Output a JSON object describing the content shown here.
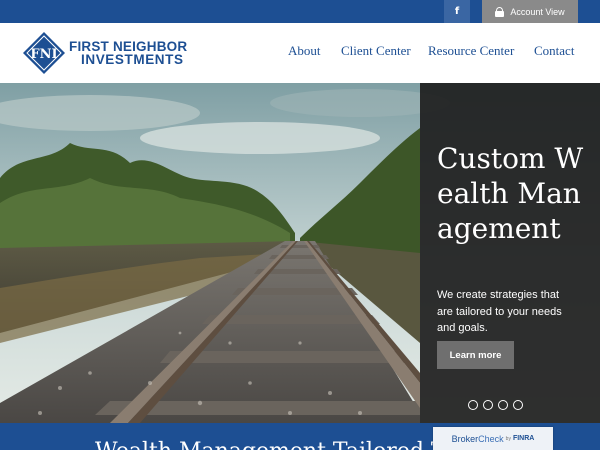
{
  "topbar": {
    "facebook_label": "f",
    "account_label": "Account View"
  },
  "logo": {
    "monogram": "FNI",
    "line1": "FIRST NEIGHBOR",
    "line2": "INVESTMENTS"
  },
  "nav": [
    {
      "label": "About"
    },
    {
      "label": "Client Center"
    },
    {
      "label": "Resource Center"
    },
    {
      "label": "Contact"
    }
  ],
  "hero": {
    "title": "Custom Wealth Management",
    "text": "We create strategies that are tailored to your needs and goals.",
    "button_label": "Learn more",
    "slide_count": 4
  },
  "band": {
    "title": "Wealth Management Tailored To You"
  },
  "brokercheck": {
    "broker": "Broker",
    "check": "Check",
    "by": "by",
    "finra": "FINRA"
  },
  "colors": {
    "brand_blue": "#1d4f93",
    "panel": "#1e1e1e",
    "button_gray": "#6f6f6f"
  },
  "icons": [
    "facebook-icon",
    "lock-icon",
    "fni-diamond-logo"
  ]
}
